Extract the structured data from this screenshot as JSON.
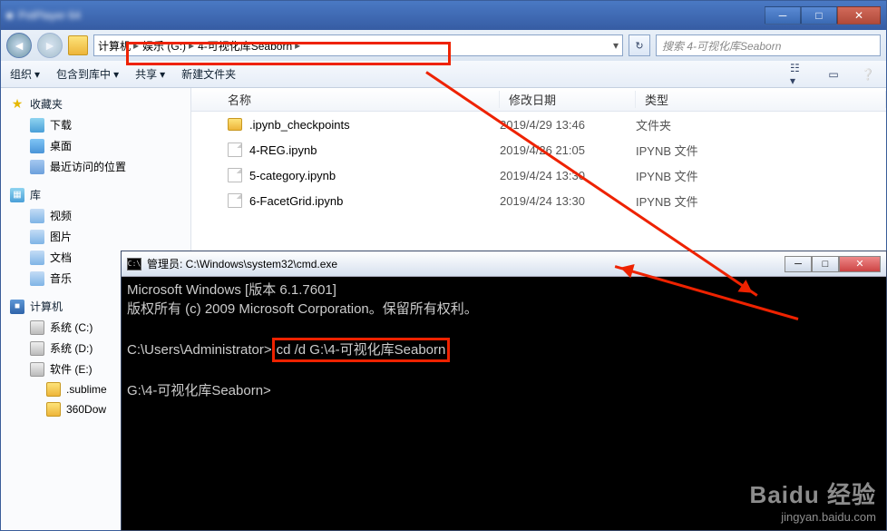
{
  "explorer": {
    "breadcrumb": [
      {
        "label": "计算机"
      },
      {
        "label": "娱乐 (G:)"
      },
      {
        "label": "4-可视化库Seaborn"
      }
    ],
    "search_placeholder": "搜索 4-可视化库Seaborn",
    "toolbar": {
      "organize": "组织",
      "include": "包含到库中",
      "share": "共享",
      "newfolder": "新建文件夹"
    },
    "columns": {
      "name": "名称",
      "date": "修改日期",
      "type": "类型"
    },
    "files": [
      {
        "icon": "folder",
        "name": ".ipynb_checkpoints",
        "date": "2019/4/29 13:46",
        "type": "文件夹"
      },
      {
        "icon": "file",
        "name": "4-REG.ipynb",
        "date": "2019/4/26 21:05",
        "type": "IPYNB 文件"
      },
      {
        "icon": "file",
        "name": "5-category.ipynb",
        "date": "2019/4/24 13:30",
        "type": "IPYNB 文件"
      },
      {
        "icon": "file",
        "name": "6-FacetGrid.ipynb",
        "date": "2019/4/24 13:30",
        "type": "IPYNB 文件"
      }
    ],
    "sidebar": {
      "favorites": {
        "label": "收藏夹",
        "items": [
          "下载",
          "桌面",
          "最近访问的位置"
        ]
      },
      "libraries": {
        "label": "库",
        "items": [
          "视频",
          "图片",
          "文档",
          "音乐"
        ]
      },
      "computer": {
        "label": "计算机",
        "items": [
          "系统 (C:)",
          "系统 (D:)",
          "软件 (E:)"
        ],
        "sub": [
          ".sublime",
          "360Dow"
        ]
      }
    }
  },
  "cmd": {
    "title": "管理员: C:\\Windows\\system32\\cmd.exe",
    "line1": "Microsoft Windows [版本 6.1.7601]",
    "line2": "版权所有 (c) 2009 Microsoft Corporation。保留所有权利。",
    "prompt1_pre": "C:\\Users\\Administrator>",
    "prompt1_cmd": "cd /d G:\\4-可视化库Seaborn",
    "prompt2": "G:\\4-可视化库Seaborn>"
  },
  "watermark": {
    "brand": "Baidu 经验",
    "url": "jingyan.baidu.com"
  }
}
